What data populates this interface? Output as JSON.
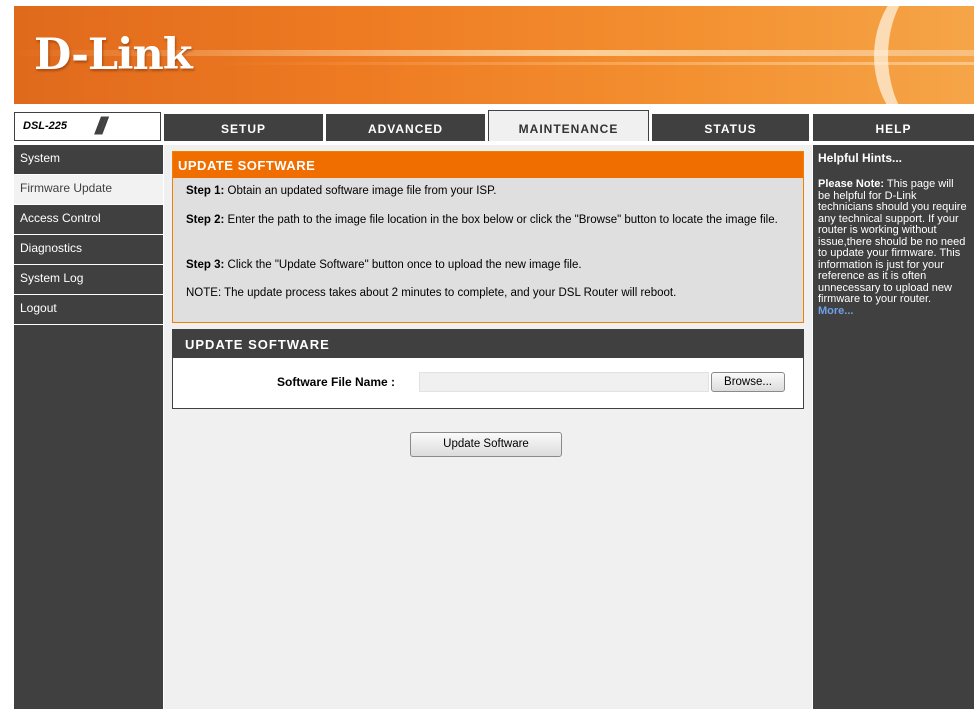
{
  "brand": {
    "logo_text": "D-Link"
  },
  "nav": {
    "model": "DSL-225",
    "tabs": [
      {
        "label": "SETUP"
      },
      {
        "label": "ADVANCED"
      },
      {
        "label": "MAINTENANCE"
      },
      {
        "label": "STATUS"
      },
      {
        "label": "HELP"
      }
    ],
    "active_tab": "MAINTENANCE"
  },
  "sidebar": {
    "items": [
      {
        "label": "System"
      },
      {
        "label": "Firmware Update"
      },
      {
        "label": "Access Control"
      },
      {
        "label": "Diagnostics"
      },
      {
        "label": "System Log"
      },
      {
        "label": "Logout"
      }
    ],
    "active_item": "Firmware Update"
  },
  "info_section": {
    "title": "UPDATE SOFTWARE",
    "step1_label": "Step 1:",
    "step1_text": " Obtain an updated software image file from your ISP.",
    "step2_label": "Step 2:",
    "step2_text": " Enter the path to the image file location in the box below or click the \"Browse\" button to locate the image file.",
    "step3_label": "Step 3:",
    "step3_text": " Click the \"Update Software\" button once to upload the new image file.",
    "note": "NOTE: The update process takes about 2 minutes to complete, and your DSL Router will reboot."
  },
  "form_section": {
    "title": "UPDATE SOFTWARE",
    "file_label": "Software File Name :",
    "file_value": "",
    "browse_label": "Browse...",
    "update_button": "Update Software"
  },
  "help": {
    "title": "Helpful Hints...",
    "note_label": "Please Note:",
    "text": " This page will be helpful for D-Link technicians should you require any technical support. If your router is working without issue,there should be no need to update your firmware. This information is just for your reference as it is often unnecessary to upload new firmware to your router.",
    "more_link": "More..."
  },
  "colors": {
    "accent_orange": "#f06d00",
    "dark_gray": "#404040",
    "help_link": "#6ea0e8"
  }
}
